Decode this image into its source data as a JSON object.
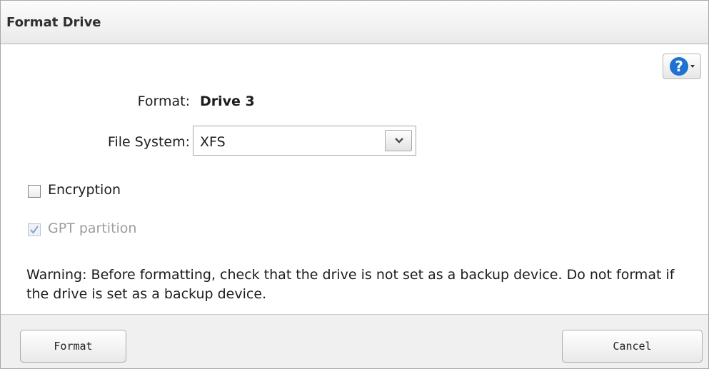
{
  "dialog": {
    "title": "Format Drive"
  },
  "help": {
    "icon": "help-icon",
    "glyph": "?"
  },
  "form": {
    "format_label": "Format:",
    "format_value": "Drive 3",
    "filesystem_label": "File System:",
    "filesystem_value": "XFS"
  },
  "options": {
    "encryption": {
      "label": "Encryption",
      "checked": false,
      "enabled": true
    },
    "gpt": {
      "label": "GPT partition",
      "checked": true,
      "enabled": false
    }
  },
  "warning": "Warning: Before formatting, check that the drive is not set as a backup device. Do not format if the drive is set as a backup device.",
  "buttons": {
    "format": "Format",
    "cancel": "Cancel"
  },
  "colors": {
    "help_blue": "#1f72d2",
    "disabled_text": "#9c9c9c"
  }
}
